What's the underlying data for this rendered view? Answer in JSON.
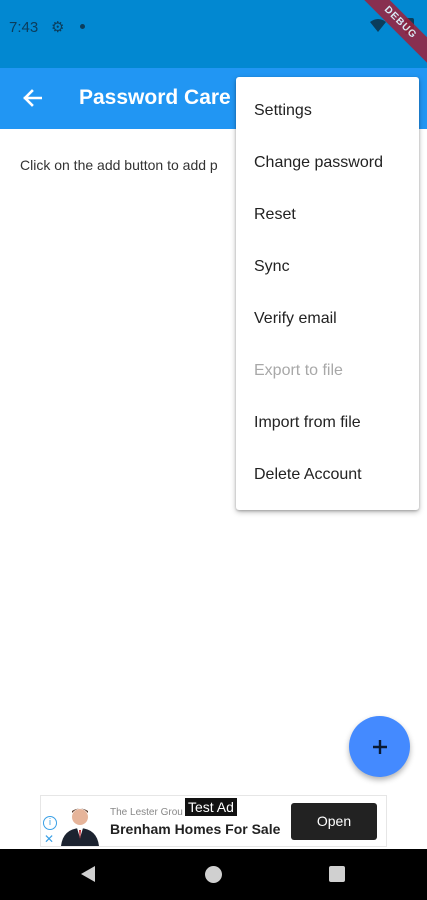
{
  "status_bar": {
    "time": "7:43",
    "settings_icon": "gear-icon",
    "wifi_icon": "wifi-icon",
    "battery_icon": "battery-icon",
    "debug_banner": "DEBUG"
  },
  "app_bar": {
    "title": "Password Care",
    "back_icon": "arrow-left-icon",
    "color": "#2196f3"
  },
  "main": {
    "empty_message": "Click on the add button to add p"
  },
  "overflow_menu": {
    "items": [
      {
        "label": "Settings",
        "enabled": true
      },
      {
        "label": "Change password",
        "enabled": true
      },
      {
        "label": "Reset",
        "enabled": true
      },
      {
        "label": "Sync",
        "enabled": true
      },
      {
        "label": "Verify email",
        "enabled": true
      },
      {
        "label": "Export to file",
        "enabled": false
      },
      {
        "label": "Import from file",
        "enabled": true
      },
      {
        "label": "Delete Account",
        "enabled": true
      }
    ]
  },
  "fab": {
    "icon": "plus-icon",
    "color": "#448aff"
  },
  "ad": {
    "advertiser": "The Lester Grou",
    "test_label": "Test Ad",
    "headline": "Brenham Homes For Sale",
    "cta": "Open",
    "info_icon": "info-icon",
    "close_icon": "close-icon"
  },
  "nav_bar": {
    "back_icon": "triangle-back-icon",
    "home_icon": "circle-home-icon",
    "recents_icon": "square-recents-icon"
  }
}
